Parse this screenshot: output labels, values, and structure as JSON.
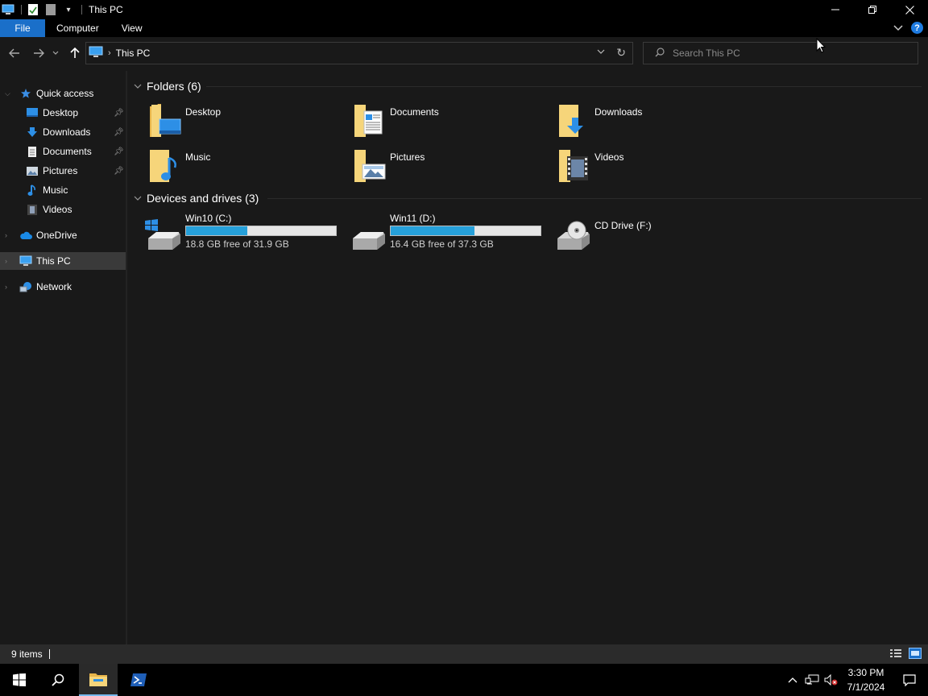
{
  "window": {
    "title": "This PC",
    "controls": {
      "minimize": "—",
      "maximize": "❐",
      "close": "✕"
    }
  },
  "ribbon": {
    "tabs": [
      "File",
      "Computer",
      "View"
    ],
    "help": "?"
  },
  "navigation": {
    "back_icon": "arrow-left-icon",
    "forward_icon": "arrow-right-icon",
    "up_icon": "arrow-up-icon",
    "address_path": "This PC",
    "search_placeholder": "Search This PC"
  },
  "sidebar": {
    "items": [
      {
        "label": "Quick access",
        "icon": "star-icon",
        "pinned": false
      },
      {
        "label": "Desktop",
        "icon": "desktop-icon",
        "pinned": true
      },
      {
        "label": "Downloads",
        "icon": "download-icon",
        "pinned": true
      },
      {
        "label": "Documents",
        "icon": "document-icon",
        "pinned": true
      },
      {
        "label": "Pictures",
        "icon": "pictures-icon",
        "pinned": true
      },
      {
        "label": "Music",
        "icon": "music-icon",
        "pinned": false
      },
      {
        "label": "Videos",
        "icon": "videos-icon",
        "pinned": false
      },
      {
        "label": "OneDrive",
        "icon": "cloud-icon",
        "pinned": false
      },
      {
        "label": "This PC",
        "icon": "computer-icon",
        "pinned": false,
        "selected": true
      },
      {
        "label": "Network",
        "icon": "network-icon",
        "pinned": false
      }
    ]
  },
  "content": {
    "folders_header": "Folders (6)",
    "folders": [
      {
        "label": "Desktop",
        "icon": "desktop-folder-icon"
      },
      {
        "label": "Documents",
        "icon": "documents-folder-icon"
      },
      {
        "label": "Downloads",
        "icon": "downloads-folder-icon"
      },
      {
        "label": "Music",
        "icon": "music-folder-icon"
      },
      {
        "label": "Pictures",
        "icon": "pictures-folder-icon"
      },
      {
        "label": "Videos",
        "icon": "videos-folder-icon"
      }
    ],
    "drives_header": "Devices and drives (3)",
    "drives": [
      {
        "name": "Win10 (C:)",
        "free_text": "18.8 GB free of 31.9 GB",
        "used_fraction": 0.41
      },
      {
        "name": "Win11 (D:)",
        "free_text": "16.4 GB free of 37.3 GB",
        "used_fraction": 0.56
      },
      {
        "name": "CD Drive (F:)",
        "free_text": "",
        "used_fraction": null
      }
    ]
  },
  "status": {
    "item_count": "9 items"
  },
  "taskbar": {
    "time": "3:30 PM",
    "date": "7/1/2024"
  },
  "colors": {
    "accent": "#1a6fc9",
    "drive_bar": "#26a0da",
    "background": "#191919"
  }
}
